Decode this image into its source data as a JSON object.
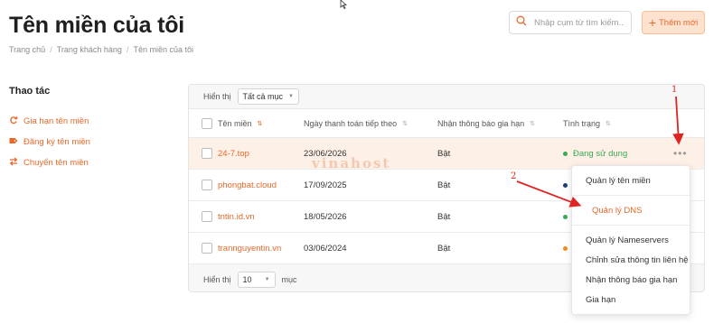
{
  "header": {
    "title": "Tên miền của tôi",
    "breadcrumb": [
      "Trang chủ",
      "Trang khách hàng",
      "Tên miền của tôi"
    ],
    "search_placeholder": "Nhập cụm từ tìm kiếm...",
    "add_button": "Thêm mới"
  },
  "sidebar": {
    "title": "Thao tác",
    "items": [
      {
        "label": "Gia hạn tên miền",
        "icon": "renew-icon"
      },
      {
        "label": "Đăng ký tên miền",
        "icon": "tag-icon"
      },
      {
        "label": "Chuyển tên miền",
        "icon": "transfer-icon"
      }
    ]
  },
  "table": {
    "show_label": "Hiển thị",
    "filter_value": "Tất cả mục",
    "columns": [
      "Tên miền",
      "Ngày thanh toán tiếp theo",
      "Nhận thông báo gia hạn",
      "Tình trạng"
    ],
    "rows": [
      {
        "domain": "24-7.top",
        "date": "23/06/2026",
        "notify": "Bật",
        "status": "Đang sử dụng",
        "status_color": "#3aa856"
      },
      {
        "domain": "phongbat.cloud",
        "date": "17/09/2025",
        "notify": "Bật",
        "status": "",
        "status_color": "#1c3f73"
      },
      {
        "domain": "tntin.id.vn",
        "date": "18/05/2026",
        "notify": "Bật",
        "status": "",
        "status_color": "#3aa856"
      },
      {
        "domain": "trannguyentin.vn",
        "date": "03/06/2024",
        "notify": "Bật",
        "status": "",
        "status_color": "#f08a1c"
      }
    ],
    "footer_show": "Hiển thị",
    "page_size": "10",
    "footer_unit": "mục"
  },
  "menu": {
    "items": [
      "Quản lý tên miền",
      "Quản lý DNS",
      "Quản lý Nameservers",
      "Chỉnh sửa thông tin liên hệ",
      "Nhận thông báo gia hạn",
      "Gia hạn"
    ]
  },
  "annotations": {
    "one": "1",
    "two": "2",
    "watermark": "vinahost"
  },
  "colors": {
    "accent": "#e8682a",
    "arrow": "#e02424"
  }
}
